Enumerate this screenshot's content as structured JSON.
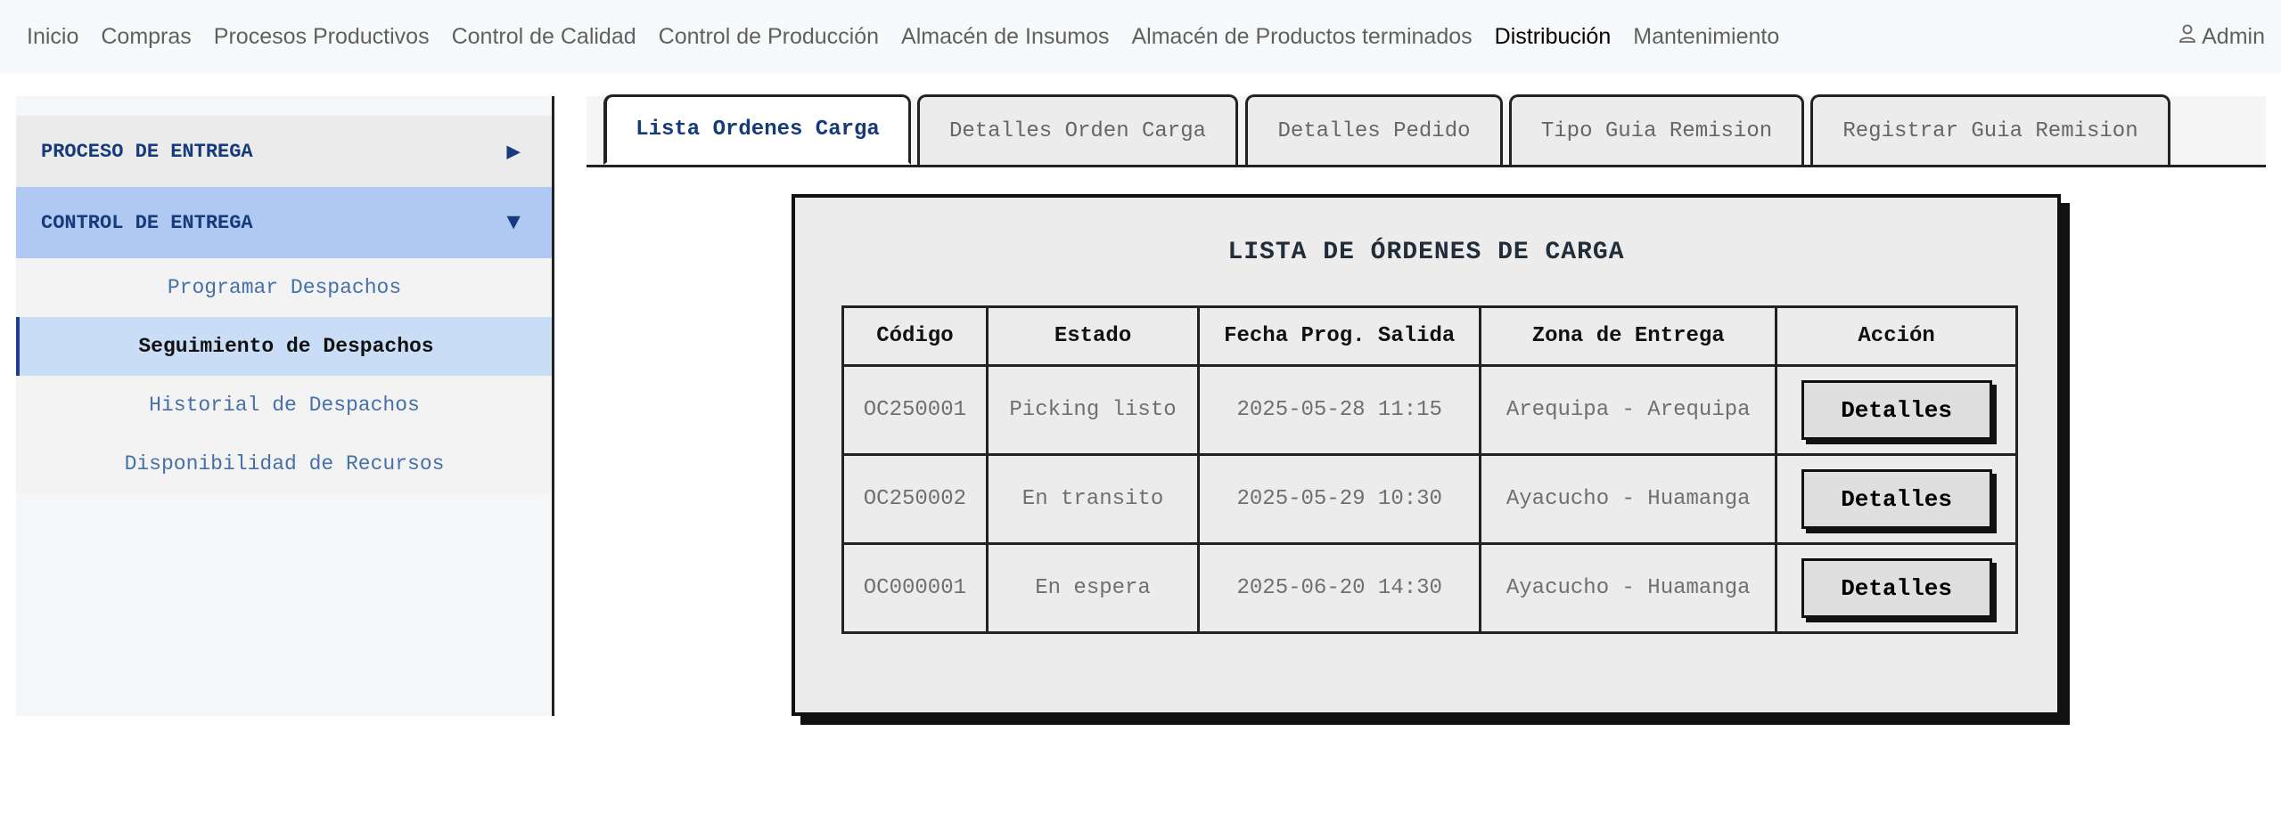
{
  "navbar": {
    "items": [
      {
        "label": "Inicio"
      },
      {
        "label": "Compras"
      },
      {
        "label": "Procesos Productivos"
      },
      {
        "label": "Control de Calidad"
      },
      {
        "label": "Control de Producción"
      },
      {
        "label": "Almacén de Insumos"
      },
      {
        "label": "Almacén de Productos terminados"
      },
      {
        "label": "Distribución"
      },
      {
        "label": "Mantenimiento"
      }
    ],
    "active": "Distribución",
    "user_label": "Admin",
    "user_icon": "person-icon"
  },
  "sidebar": {
    "sections": [
      {
        "label": "PROCESO DE ENTREGA",
        "state": "collapsed",
        "arrow": "▶"
      },
      {
        "label": "CONTROL DE ENTREGA",
        "state": "expanded",
        "arrow": "▼"
      }
    ],
    "sub_items": [
      {
        "label": "Programar Despachos"
      },
      {
        "label": "Seguimiento de Despachos"
      },
      {
        "label": "Historial de Despachos"
      },
      {
        "label": "Disponibilidad de Recursos"
      }
    ],
    "active_sub_item": "Seguimiento de Despachos"
  },
  "tabs": [
    {
      "label": "Lista Ordenes Carga"
    },
    {
      "label": "Detalles Orden Carga"
    },
    {
      "label": "Detalles Pedido"
    },
    {
      "label": "Tipo Guia Remision"
    },
    {
      "label": "Registrar Guia Remision"
    }
  ],
  "active_tab": "Lista Ordenes Carga",
  "panel": {
    "title": "LISTA DE ÓRDENES DE CARGA",
    "columns": [
      "Código",
      "Estado",
      "Fecha Prog. Salida",
      "Zona de Entrega",
      "Acción"
    ],
    "rows": [
      {
        "code": "OC250001",
        "status": "Picking listo",
        "date": "2025-05-28 11:15",
        "zone": "Arequipa - Arequipa",
        "action": "Detalles"
      },
      {
        "code": "OC250002",
        "status": "En transito",
        "date": "2025-05-29 10:30",
        "zone": "Ayacucho - Huamanga",
        "action": "Detalles"
      },
      {
        "code": "OC000001",
        "status": "En espera",
        "date": "2025-06-20 14:30",
        "zone": "Ayacucho - Huamanga",
        "action": "Detalles"
      }
    ]
  },
  "colors": {
    "active_section": "#afc9f3",
    "active_sub_item": "#c9ddf7",
    "link_text": "#4670a8",
    "section_text": "#163a7a"
  }
}
